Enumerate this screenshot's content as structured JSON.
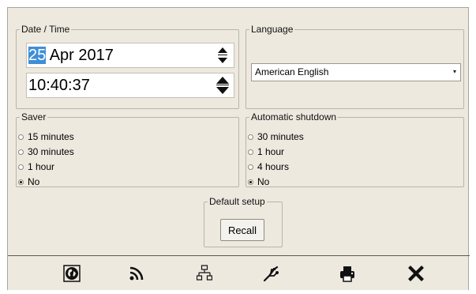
{
  "datetime": {
    "legend": "Date / Time",
    "date_day": "25",
    "date_rest": " Apr 2017",
    "time": "10:40:37"
  },
  "language": {
    "legend": "Language",
    "selected": "American English"
  },
  "saver": {
    "legend": "Saver",
    "options": [
      "15 minutes",
      "30 minutes",
      "1 hour",
      "No"
    ],
    "selected": "No"
  },
  "shutdown": {
    "legend": "Automatic shutdown",
    "options": [
      "30 minutes",
      "1 hour",
      "4 hours",
      "No"
    ],
    "selected": "No"
  },
  "default_setup": {
    "legend": "Default setup",
    "button": "Recall"
  },
  "toolbar": {
    "icons": [
      "globe-icon",
      "wifi-icon",
      "network-icon",
      "usb-icon",
      "printer-icon",
      "close-icon"
    ]
  }
}
